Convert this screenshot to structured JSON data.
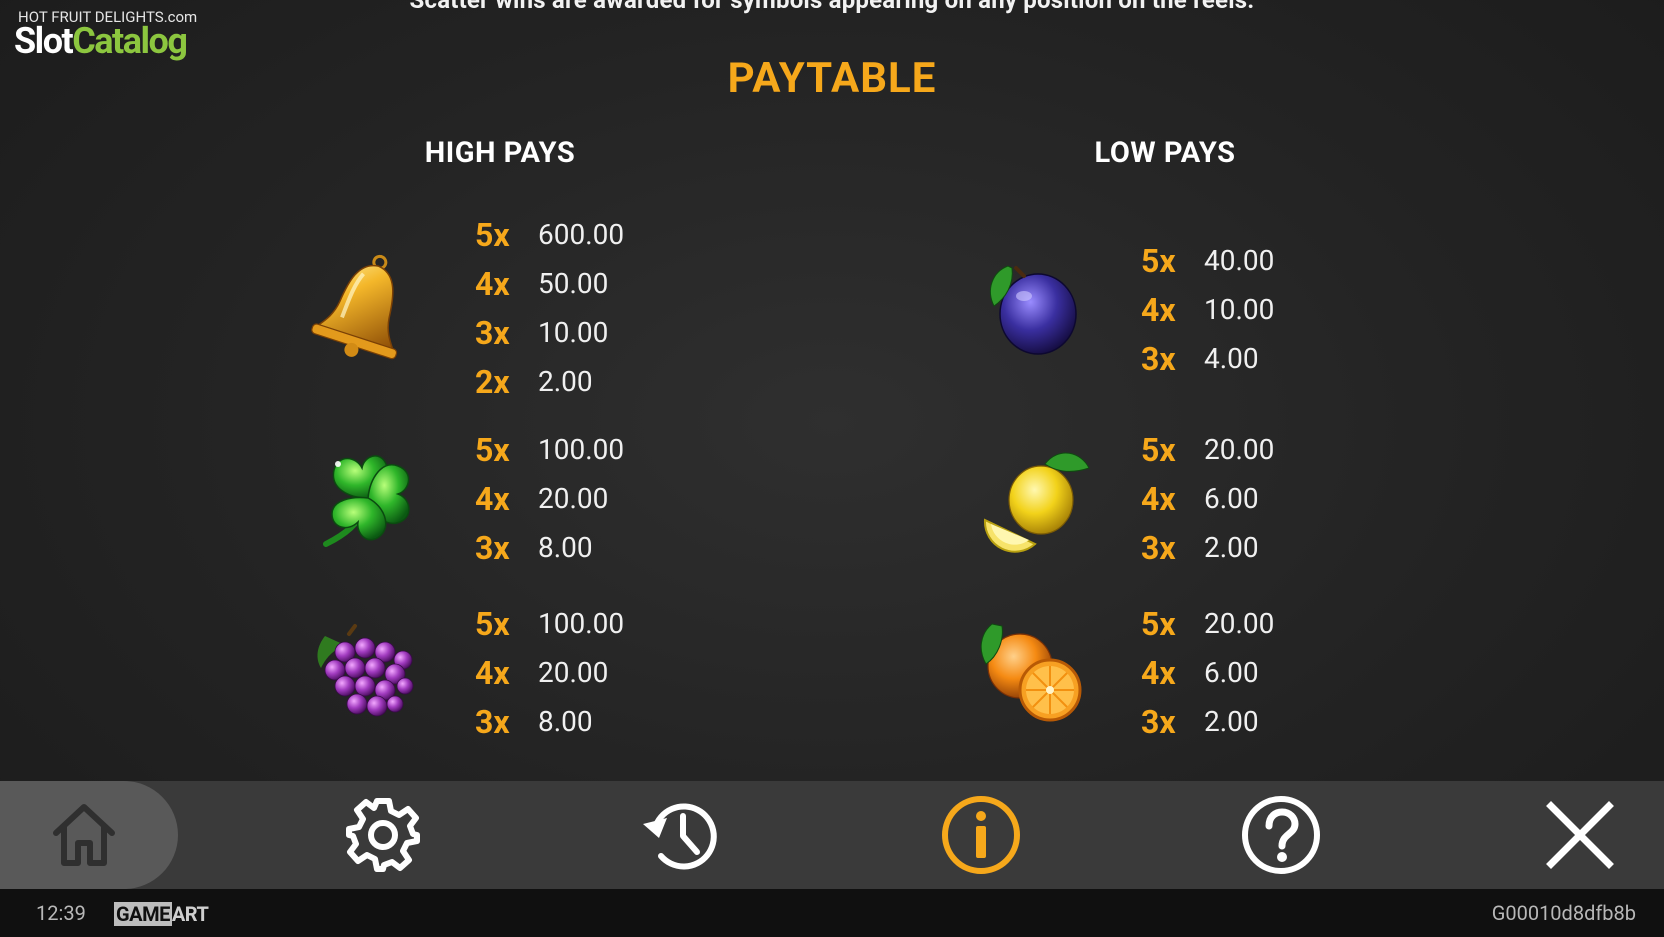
{
  "top_note": "Scatter wins are awarded for symbols appearing on any position on the reels.",
  "watermark": {
    "game_name": "HOT FRUIT DELIGHTS",
    "logo_part1": "Slot",
    "logo_part2": "Catalog",
    "logo_suffix": ".com"
  },
  "title": "PAYTABLE",
  "high_pays": {
    "heading": "HIGH PAYS",
    "symbols": [
      {
        "icon": "bell-icon",
        "pays": [
          {
            "mult": "5x",
            "amount": "600.00"
          },
          {
            "mult": "4x",
            "amount": "50.00"
          },
          {
            "mult": "3x",
            "amount": "10.00"
          },
          {
            "mult": "2x",
            "amount": "2.00"
          }
        ]
      },
      {
        "icon": "clover-icon",
        "pays": [
          {
            "mult": "5x",
            "amount": "100.00"
          },
          {
            "mult": "4x",
            "amount": "20.00"
          },
          {
            "mult": "3x",
            "amount": "8.00"
          }
        ]
      },
      {
        "icon": "grapes-icon",
        "pays": [
          {
            "mult": "5x",
            "amount": "100.00"
          },
          {
            "mult": "4x",
            "amount": "20.00"
          },
          {
            "mult": "3x",
            "amount": "8.00"
          }
        ]
      }
    ]
  },
  "low_pays": {
    "heading": "LOW PAYS",
    "symbols": [
      {
        "icon": "plum-icon",
        "pays": [
          {
            "mult": "5x",
            "amount": "40.00"
          },
          {
            "mult": "4x",
            "amount": "10.00"
          },
          {
            "mult": "3x",
            "amount": "4.00"
          }
        ]
      },
      {
        "icon": "lemon-icon",
        "pays": [
          {
            "mult": "5x",
            "amount": "20.00"
          },
          {
            "mult": "4x",
            "amount": "6.00"
          },
          {
            "mult": "3x",
            "amount": "2.00"
          }
        ]
      },
      {
        "icon": "orange-icon",
        "pays": [
          {
            "mult": "5x",
            "amount": "20.00"
          },
          {
            "mult": "4x",
            "amount": "6.00"
          },
          {
            "mult": "3x",
            "amount": "2.00"
          }
        ]
      }
    ]
  },
  "nav": [
    "home-icon",
    "settings-icon",
    "history-icon",
    "info-icon",
    "help-icon",
    "close-icon"
  ],
  "colors": {
    "accent": "#f6a81b",
    "bar": "#3a3a3a",
    "home_bg": "#595959"
  },
  "status": {
    "time": "12:39",
    "provider_a": "GAME",
    "provider_b": "ART",
    "session_id": "G00010d8dfb8b"
  }
}
